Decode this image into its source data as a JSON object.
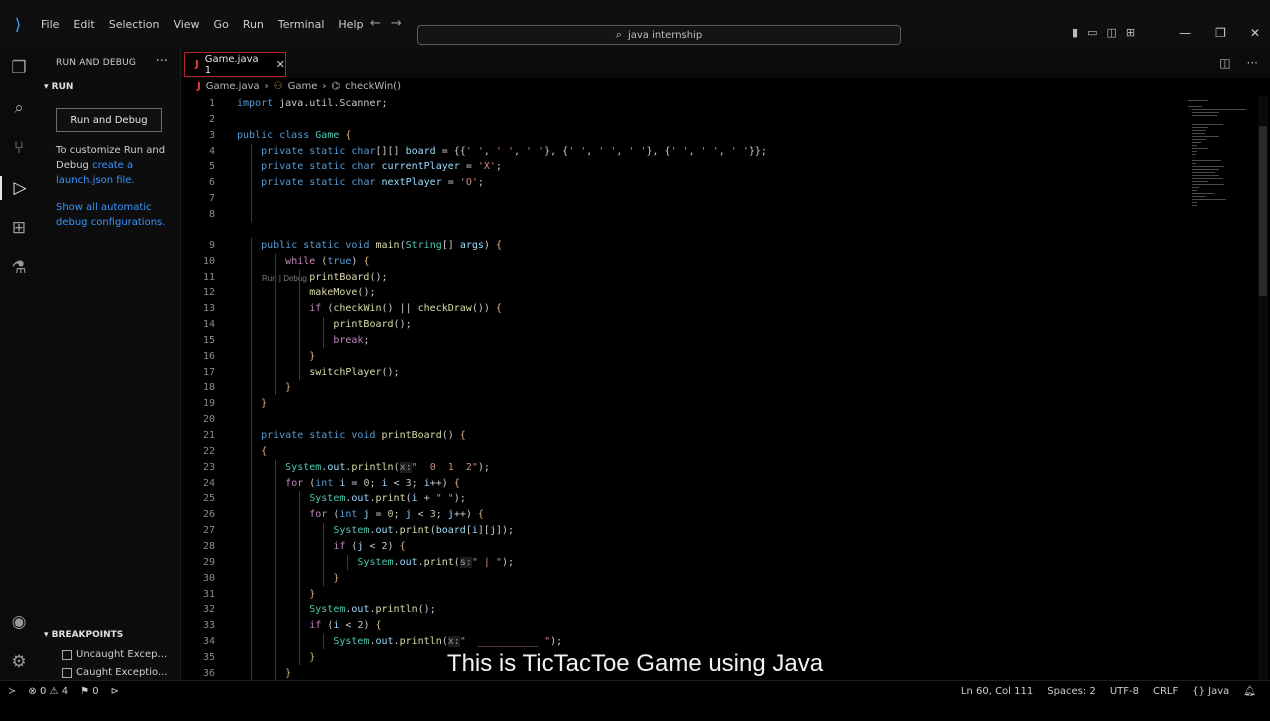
{
  "titlebar": {
    "menu": [
      "File",
      "Edit",
      "Selection",
      "View",
      "Go",
      "Run",
      "Terminal",
      "Help"
    ],
    "search_text": "java internship"
  },
  "sidebar": {
    "title": "RUN AND DEBUG",
    "section": "RUN",
    "run_button": "Run and Debug",
    "customize_text": "To customize Run and Debug",
    "customize_link": "create a launch.json file.",
    "show_all_link": "Show all automatic debug configurations.",
    "breakpoints_title": "BREAKPOINTS",
    "breakpoints": [
      "Uncaught Excep...",
      "Caught Exceptio..."
    ]
  },
  "editor": {
    "tab_label": "Game.java 1",
    "breadcrumb": {
      "file": "Game.java",
      "class": "Game",
      "method": "checkWin()"
    },
    "codelens": "Run | Debug",
    "lines": [
      {
        "n": "1",
        "html": "<span class='kw'>import</span> java.util.Scanner;"
      },
      {
        "n": "2",
        "html": ""
      },
      {
        "n": "3",
        "html": "<span class='kw'>public class</span> <span class='ty'>Game</span> <span class='br'>{</span>"
      },
      {
        "n": "4",
        "html": "    <span class='kw'>private static char</span>[][] <span class='var'>board</span> = {{<span class='str'>' '</span>, <span class='str'>' '</span>, <span class='str'>' '</span>}, {<span class='str'>' '</span>, <span class='str'>' '</span>, <span class='str'>' '</span>}, {<span class='str'>' '</span>, <span class='str'>' '</span>, <span class='str'>' '</span>}};"
      },
      {
        "n": "5",
        "html": "    <span class='kw'>private static char</span> <span class='var'>currentPlayer</span> = <span class='str'>'X'</span>;"
      },
      {
        "n": "6",
        "html": "    <span class='kw'>private static char</span> <span class='var'>nextPlayer</span> = <span class='str'>'O'</span>;"
      },
      {
        "n": "7",
        "html": ""
      },
      {
        "n": "8",
        "html": ""
      },
      {
        "n": "9",
        "html": "    <span class='kw'>public static void</span> <span class='fn'>main</span>(<span class='ty'>String</span>[] <span class='var'>args</span>) <span class='br'>{</span>"
      },
      {
        "n": "10",
        "html": "        <span class='ctrl'>while</span> (<span class='kw'>true</span>) <span class='br'>{</span>"
      },
      {
        "n": "11",
        "html": "            <span class='fn'>printBoard</span>();"
      },
      {
        "n": "12",
        "html": "            <span class='fn'>makeMove</span>();"
      },
      {
        "n": "13",
        "html": "            <span class='ctrl'>if</span> (<span class='fn'>checkWin</span>() || <span class='fn'>checkDraw</span>()) <span class='br'>{</span>"
      },
      {
        "n": "14",
        "html": "                <span class='fn'>printBoard</span>();"
      },
      {
        "n": "15",
        "html": "                <span class='ctrl'>break</span>;"
      },
      {
        "n": "16",
        "html": "            <span class='br'>}</span>"
      },
      {
        "n": "17",
        "html": "            <span class='fn'>switchPlayer</span>();"
      },
      {
        "n": "18",
        "html": "        <span class='br'>}</span>"
      },
      {
        "n": "19",
        "html": "    <span class='br'>}</span>"
      },
      {
        "n": "20",
        "html": ""
      },
      {
        "n": "21",
        "html": "    <span class='kw'>private static void</span> <span class='fn'>printBoard</span>() <span class='br'>{</span>"
      },
      {
        "n": "22",
        "html": "    <span class='br'>{</span>"
      },
      {
        "n": "23",
        "html": "        <span class='ty'>System</span>.<span class='var'>out</span>.<span class='fn'>println</span>(<span class='hint'>x:</span><span class='str'>\"  0  1  2\"</span>);"
      },
      {
        "n": "24",
        "html": "        <span class='ctrl'>for</span> (<span class='kw'>int</span> <span class='var'>i</span> = <span class='num'>0</span>; <span class='var'>i</span> &lt; <span class='num'>3</span>; <span class='var'>i</span>++) <span class='br'>{</span>"
      },
      {
        "n": "25",
        "html": "            <span class='ty'>System</span>.<span class='var'>out</span>.<span class='fn'>print</span>(<span class='var'>i</span> + <span class='str'>\" \"</span>);"
      },
      {
        "n": "26",
        "html": "            <span class='ctrl'>for</span> (<span class='kw'>int</span> <span class='var'>j</span> = <span class='num'>0</span>; <span class='var'>j</span> &lt; <span class='num'>3</span>; <span class='var'>j</span>++) <span class='br'>{</span>"
      },
      {
        "n": "27",
        "html": "                <span class='ty'>System</span>.<span class='var'>out</span>.<span class='fn'>print</span>(<span class='var'>board</span>[<span class='var'>i</span>][<span class='var'>j</span>]);"
      },
      {
        "n": "28",
        "html": "                <span class='ctrl'>if</span> (<span class='var'>j</span> &lt; <span class='num'>2</span>) <span class='br'>{</span>"
      },
      {
        "n": "29",
        "html": "                    <span class='ty'>System</span>.<span class='var'>out</span>.<span class='fn'>print</span>(<span class='hint'>s:</span><span class='str'>\" | \"</span>);"
      },
      {
        "n": "30",
        "html": "                <span class='br'>}</span>"
      },
      {
        "n": "31",
        "html": "            <span class='br'>}</span>"
      },
      {
        "n": "32",
        "html": "            <span class='ty'>System</span>.<span class='var'>out</span>.<span class='fn'>println</span>();"
      },
      {
        "n": "33",
        "html": "            <span class='ctrl'>if</span> (<span class='var'>i</span> &lt; <span class='num'>2</span>) <span class='br'>{</span>"
      },
      {
        "n": "34",
        "html": "                <span class='ty'>System</span>.<span class='var'>out</span>.<span class='fn'>println</span>(<span class='hint'>x:</span><span class='str'>\"  __________ \"</span>);"
      },
      {
        "n": "35",
        "html": "            <span class='br'>}</span>"
      },
      {
        "n": "36",
        "html": "        <span class='br'>}</span>"
      }
    ]
  },
  "subtitle": "This is TicTacToe Game using Java",
  "statusbar": {
    "errors": "0",
    "warnings": "4",
    "ports": "0",
    "position": "Ln 60, Col 111",
    "spaces": "Spaces: 2",
    "encoding": "UTF-8",
    "eol": "CRLF",
    "language": "Java"
  }
}
